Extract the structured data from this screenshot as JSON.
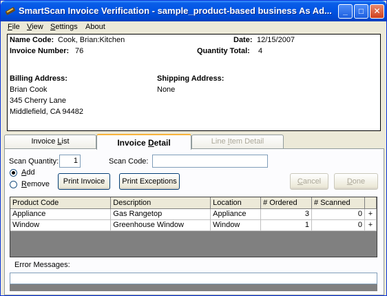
{
  "window": {
    "title": "SmartScan Invoice Verification - sample_product-based business As Ad...",
    "minimize_glyph": "_",
    "maximize_glyph": "□",
    "close_glyph": "✕"
  },
  "menu": {
    "items": [
      {
        "label": "File",
        "mnemonic": "F",
        "rest": "ile"
      },
      {
        "label": "View",
        "mnemonic": "V",
        "rest": "iew"
      },
      {
        "label": "Settings",
        "mnemonic": "S",
        "rest": "ettings"
      },
      {
        "label": "About",
        "mnemonic": "",
        "rest": "About"
      }
    ]
  },
  "header": {
    "name_code_label": "Name Code:",
    "name_code_value": "Cook, Brian:Kitchen",
    "date_label": "Date:",
    "date_value": "12/15/2007",
    "invoice_number_label": "Invoice Number:",
    "invoice_number_value": "76",
    "quantity_total_label": "Quantity Total:",
    "quantity_total_value": "4",
    "billing_label": "Billing Address:",
    "billing_lines": [
      "Brian Cook",
      "345 Cherry Lane",
      "Middlefield, CA  94482"
    ],
    "shipping_label": "Shipping Address:",
    "shipping_value": "None"
  },
  "tabs": [
    {
      "pre": "Invoice ",
      "mn": "L",
      "post": "ist",
      "active": false,
      "disabled": false
    },
    {
      "pre": "Invoice ",
      "mn": "D",
      "post": "etail",
      "active": true,
      "disabled": false
    },
    {
      "pre": "Line ",
      "mn": "I",
      "post": "tem Detail",
      "active": false,
      "disabled": true
    }
  ],
  "controls": {
    "scan_quantity_label": "Scan Quantity:",
    "scan_quantity_value": "1",
    "scan_code_label": "Scan Code:",
    "scan_code_value": "",
    "add_pre": "",
    "add_mn": "A",
    "add_post": "dd",
    "remove_pre": "",
    "remove_mn": "R",
    "remove_post": "emove",
    "print_invoice": "Print Invoice",
    "print_exceptions": "Print Exceptions",
    "cancel_mn": "C",
    "cancel_post": "ancel",
    "done_mn": "D",
    "done_post": "one"
  },
  "grid": {
    "columns": [
      "Product Code",
      "Description",
      "Location",
      "# Ordered",
      "# Scanned"
    ],
    "rows": [
      {
        "product_code": "Appliance",
        "description": "Gas Rangetop",
        "location": "Appliance",
        "ordered": "3",
        "scanned": "0",
        "expand": "+"
      },
      {
        "product_code": "Window",
        "description": "Greenhouse Window",
        "location": "Window",
        "ordered": "1",
        "scanned": "0",
        "expand": "+"
      }
    ]
  },
  "errors": {
    "label": "Error Messages:",
    "text": ""
  }
}
